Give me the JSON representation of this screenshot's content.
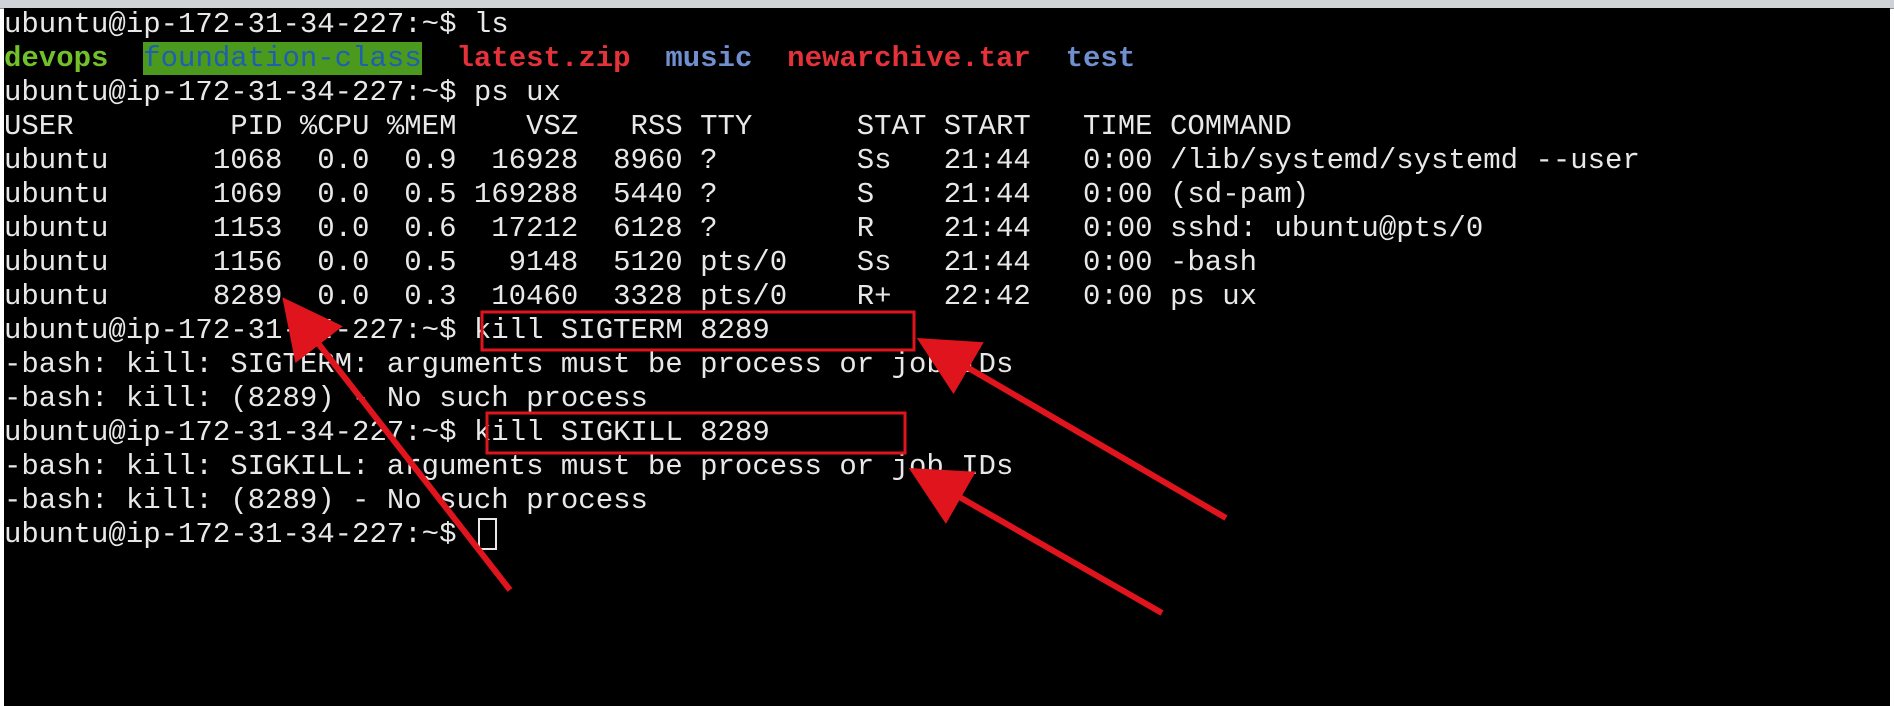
{
  "terminal": {
    "lines": [
      {
        "prompt": "ubuntu@ip-172-31-34-227:~$ ",
        "command": "ls"
      },
      {
        "ls_items": [
          {
            "name": "devops",
            "color": "#72c12a",
            "gap": "  "
          },
          {
            "name": "foundation-class",
            "color": "#1f5fb0",
            "highlight": "#4b9a1d",
            "gap": "  "
          },
          {
            "name": "latest.zip",
            "color": "#e5323a",
            "gap": "  "
          },
          {
            "name": "music",
            "color": "#6f8fcf",
            "gap": "  "
          },
          {
            "name": "newarchive.tar",
            "color": "#e5323a",
            "gap": "  "
          },
          {
            "name": "test",
            "color": "#6f8fcf",
            "gap": ""
          }
        ]
      },
      {
        "prompt": "ubuntu@ip-172-31-34-227:~$ ",
        "command": "ps ux"
      },
      {
        "text": "USER         PID %CPU %MEM    VSZ   RSS TTY      STAT START   TIME COMMAND"
      },
      {
        "text": "ubuntu      1068  0.0  0.9  16928  8960 ?        Ss   21:44   0:00 /lib/systemd/systemd --user"
      },
      {
        "text": "ubuntu      1069  0.0  0.5 169288  5440 ?        S    21:44   0:00 (sd-pam)"
      },
      {
        "text": "ubuntu      1153  0.0  0.6  17212  6128 ?        R    21:44   0:00 sshd: ubuntu@pts/0"
      },
      {
        "text": "ubuntu      1156  0.0  0.5   9148  5120 pts/0    Ss   21:44   0:00 -bash"
      },
      {
        "text": "ubuntu      8289  0.0  0.3  10460  3328 pts/0    R+   22:42   0:00 ps ux"
      },
      {
        "prompt": "ubuntu@ip-172-31-34-227:~$ ",
        "command": "kill SIGTERM 8289"
      },
      {
        "text": "-bash: kill: SIGTERM: arguments must be process or job IDs"
      },
      {
        "text": "-bash: kill: (8289) - No such process"
      },
      {
        "prompt": "ubuntu@ip-172-31-34-227:~$ ",
        "command": "kill SIGKILL 8289"
      },
      {
        "text": "-bash: kill: SIGKILL: arguments must be process or job IDs"
      },
      {
        "text": "-bash: kill: (8289) - No such process"
      },
      {
        "prompt": "ubuntu@ip-172-31-34-227:~$ ",
        "command": "",
        "cursor": true
      }
    ]
  },
  "annotations": {
    "color": "#e0141c"
  }
}
